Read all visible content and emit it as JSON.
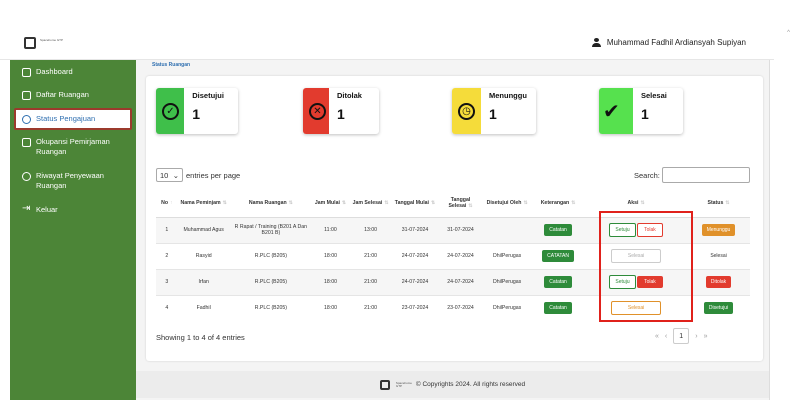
{
  "header": {
    "logo_text": "Spacehome GTP",
    "user_name": "Muhammad Fadhil Ardiansyah Supiyan"
  },
  "sidebar": {
    "items": [
      {
        "label": "Dashboard"
      },
      {
        "label": "Daftar Ruangan"
      },
      {
        "label": "Status Pengajuan"
      },
      {
        "label": "Okupansi Pemirjaman Ruangan"
      },
      {
        "label": "Riwayat Penyewaan Ruangan"
      },
      {
        "label": "Keluar"
      }
    ]
  },
  "page": {
    "breadcrumb": "Status Ruangan"
  },
  "stats": [
    {
      "label": "Disetujui",
      "value": "1",
      "color": "#3fbf4a",
      "icon": "check-circle-icon"
    },
    {
      "label": "Ditolak",
      "value": "1",
      "color": "#e23b2e",
      "icon": "x-circle-icon"
    },
    {
      "label": "Menunggu",
      "value": "1",
      "color": "#f5dc3a",
      "icon": "clock-icon"
    },
    {
      "label": "Selesai",
      "value": "1",
      "color": "#56e14e",
      "icon": "double-check-icon"
    }
  ],
  "table_controls": {
    "entries_value": "10",
    "entries_label": "entries per page",
    "search_label": "Search:",
    "showing": "Showing 1 to 4 of 4 entries"
  },
  "table": {
    "columns": [
      "No",
      "Nama Peminjam",
      "Nama Ruangan",
      "Jam Mulai",
      "Jam Selesai",
      "Tanggal Mulai",
      "Tanggal Selesai",
      "Disetujui Oleh",
      "Keterangan",
      "Aksi",
      "Status"
    ],
    "rows": [
      {
        "no": "1",
        "nama": "Muhammad Agus",
        "ruangan": "R Rapat / Training (B201 A Dan B201 B)",
        "jam_mulai": "11:00",
        "jam_selesai": "13:00",
        "tgl_mulai": "31-07-2024",
        "tgl_selesai": "31-07-2024",
        "disetujui": "",
        "keterangan": "Catatan",
        "aksi": [
          "Setuju",
          "Tolak"
        ],
        "status": "Menunggu"
      },
      {
        "no": "2",
        "nama": "Rasyid",
        "ruangan": "R.PLC (B205)",
        "jam_mulai": "18:00",
        "jam_selesai": "21:00",
        "tgl_mulai": "24-07-2024",
        "tgl_selesai": "24-07-2024",
        "disetujui": "DhilPerugas",
        "keterangan": "CATATAN",
        "aksi": [
          "Selesai"
        ],
        "status": "Selesai"
      },
      {
        "no": "3",
        "nama": "Irfan",
        "ruangan": "R.PLC (B205)",
        "jam_mulai": "18:00",
        "jam_selesai": "21:00",
        "tgl_mulai": "24-07-2024",
        "tgl_selesai": "24-07-2024",
        "disetujui": "DhilPerugas",
        "keterangan": "Catatan",
        "aksi": [
          "Setuju",
          "Tolak"
        ],
        "status": "Ditolak"
      },
      {
        "no": "4",
        "nama": "Fadhil",
        "ruangan": "R.PLC (B205)",
        "jam_mulai": "18:00",
        "jam_selesai": "21:00",
        "tgl_mulai": "23-07-2024",
        "tgl_selesai": "23-07-2024",
        "disetujui": "DhilPerugas",
        "keterangan": "Catatan",
        "aksi": [
          "Selesai"
        ],
        "status": "Disetujui"
      }
    ]
  },
  "pagination": {
    "current": "1",
    "first": "«",
    "prev": "‹",
    "next": "›",
    "last": "»"
  },
  "footer": {
    "text": "© Copyrights 2024. All rights reserved"
  }
}
